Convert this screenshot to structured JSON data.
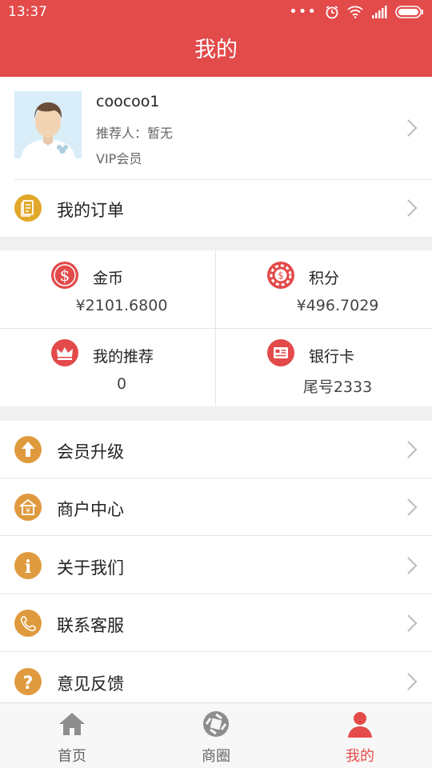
{
  "status_bar": {
    "time": "13:37"
  },
  "header": {
    "title": "我的"
  },
  "profile": {
    "username": "coocoo1",
    "referrer": "推荐人：暂无",
    "level": "VIP会员"
  },
  "orders": {
    "label": "我的订单"
  },
  "stats": [
    {
      "label": "金币",
      "value": "¥2101.6800",
      "icon": "dollar-coin-icon"
    },
    {
      "label": "积分",
      "value": "¥496.7029",
      "icon": "points-chip-icon"
    },
    {
      "label": "我的推荐",
      "value": "0",
      "icon": "crown-icon"
    },
    {
      "label": "银行卡",
      "value": "尾号2333",
      "icon": "bank-card-icon"
    }
  ],
  "menu": [
    {
      "label": "会员升级",
      "icon": "arrow-up-icon"
    },
    {
      "label": "商户中心",
      "icon": "store-icon"
    },
    {
      "label": "关于我们",
      "icon": "info-icon"
    },
    {
      "label": "联系客服",
      "icon": "phone-icon"
    },
    {
      "label": "意见反馈",
      "icon": "question-icon"
    }
  ],
  "tabs": [
    {
      "label": "首页",
      "icon": "home-icon"
    },
    {
      "label": "商圈",
      "icon": "aperture-icon"
    },
    {
      "label": "我的",
      "icon": "person-icon",
      "active": true
    }
  ],
  "colors": {
    "brand": "#e34a4a",
    "menu_icon": "#e09a3e",
    "orders_icon": "#e0a82a"
  }
}
